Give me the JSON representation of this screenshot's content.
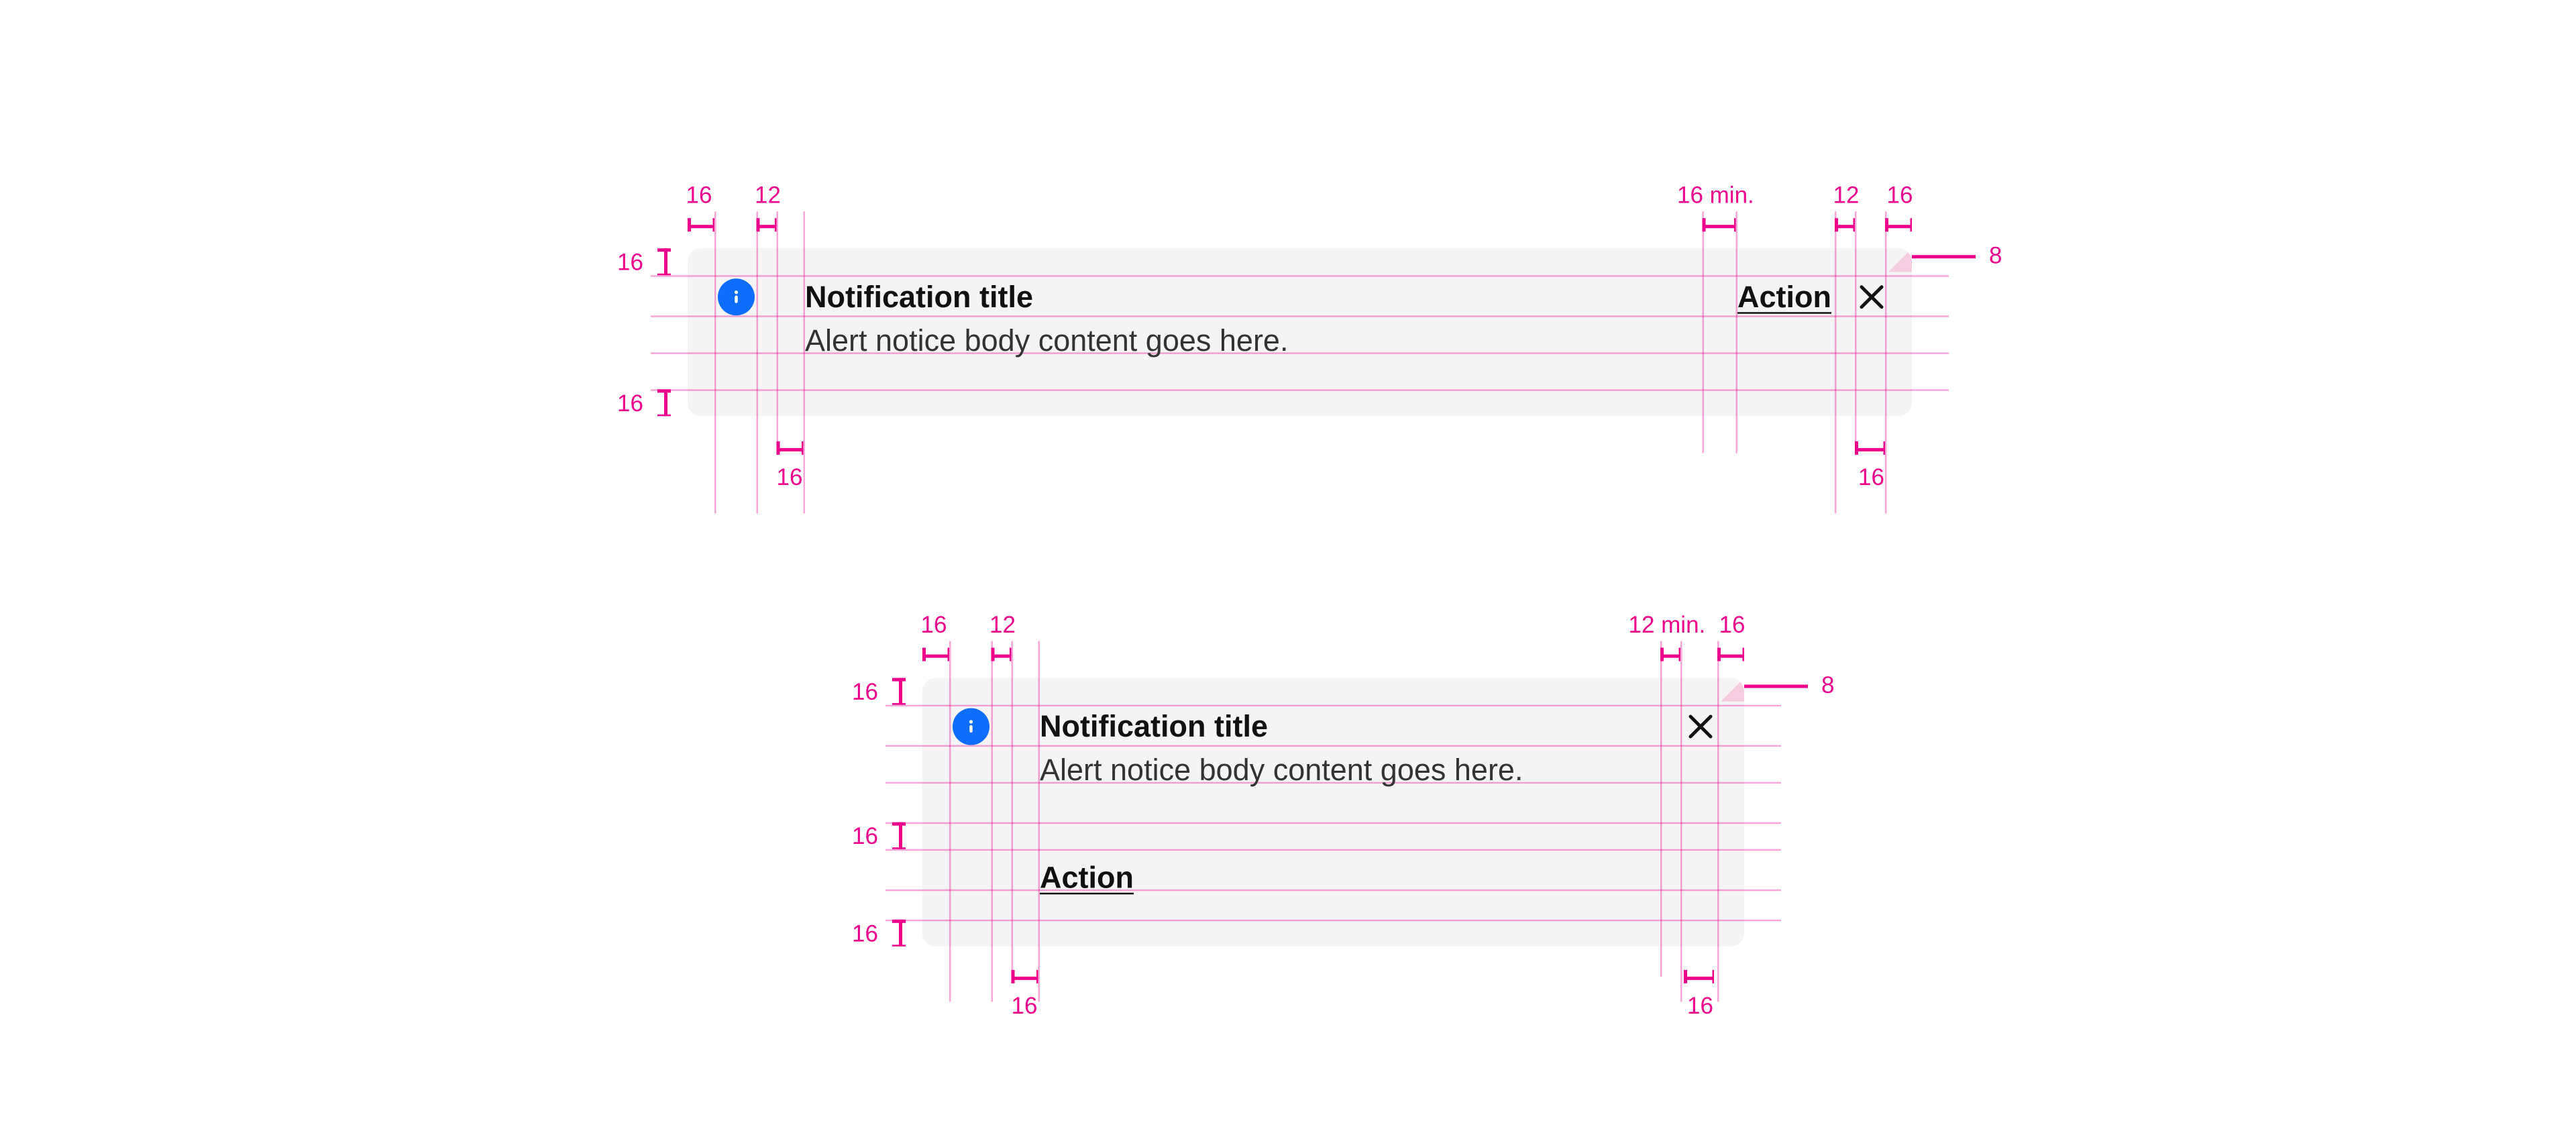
{
  "colors": {
    "spec": "#ec008c",
    "card_bg": "#f4f4f4",
    "info_icon": "#0d6efd"
  },
  "notification1": {
    "title": "Notification title",
    "body": "Alert notice body content goes here.",
    "action": "Action",
    "layout": "inline_action"
  },
  "notification2": {
    "title": "Notification title",
    "body": "Alert notice body content goes here.",
    "action": "Action",
    "layout": "stacked_action"
  },
  "spec_labels": {
    "card1": {
      "top_left_pad": "16",
      "top_icon_gap": "12",
      "top_action_gap": "16 min.",
      "top_close_gap": "12",
      "top_right_pad": "16",
      "left_top_pad": "16",
      "left_bottom_pad": "16",
      "corner_callout": "8",
      "bottom_icon": "16",
      "bottom_close": "16"
    },
    "card2": {
      "top_left_pad": "16",
      "top_icon_gap": "12",
      "top_close_gap": "12 min.",
      "top_right_pad": "16",
      "left_top_pad": "16",
      "left_mid_pad": "16",
      "left_bottom_pad": "16",
      "corner_callout": "8",
      "bottom_icon": "16",
      "bottom_close": "16"
    }
  }
}
